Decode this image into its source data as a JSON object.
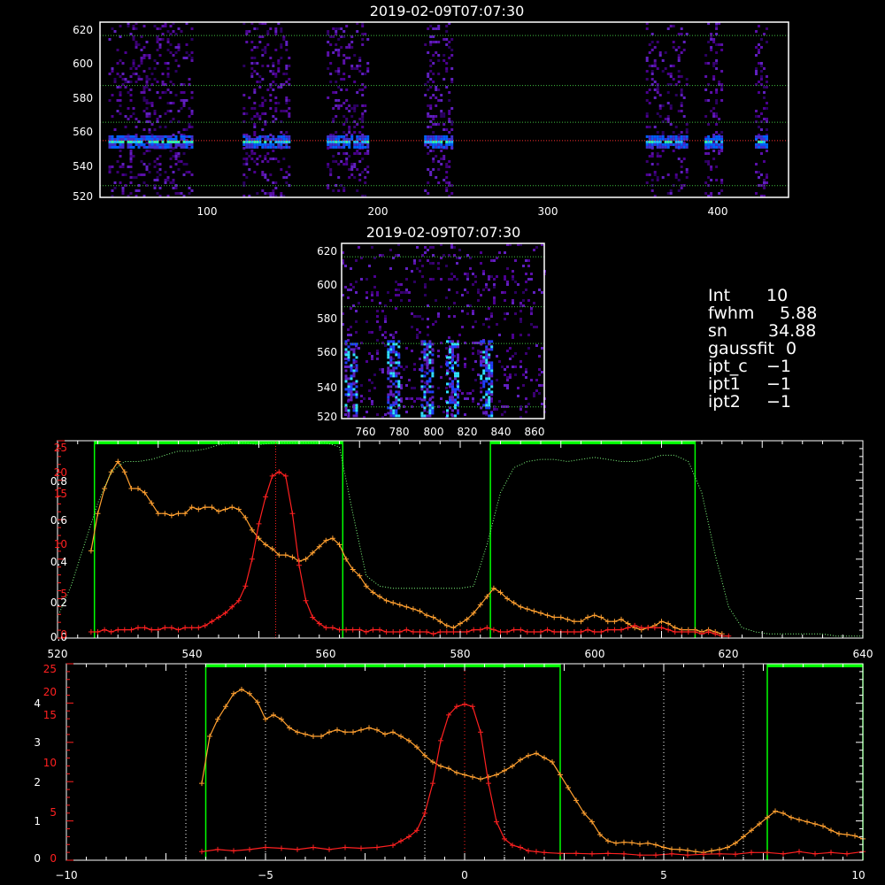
{
  "top_panel": {
    "title": "2019-02-09T07:07:30",
    "x_ticks": [
      "100",
      "200",
      "300",
      "400"
    ],
    "y_ticks": [
      "520",
      "540",
      "560",
      "580",
      "600",
      "620"
    ]
  },
  "mid_panel": {
    "title": "2019-02-09T07:07:30",
    "x_ticks": [
      "760",
      "780",
      "800",
      "820",
      "840",
      "860"
    ],
    "y_ticks": [
      "520",
      "540",
      "560",
      "580",
      "600",
      "620"
    ]
  },
  "info": {
    "rows": [
      {
        "key": "Int",
        "value": "10"
      },
      {
        "key": "fwhm",
        "value": "5.88"
      },
      {
        "key": "sn",
        "value": "34.88"
      },
      {
        "key": "gaussfit",
        "value": "0"
      },
      {
        "key": "ipt_c",
        "value": "−1"
      },
      {
        "key": "ipt1",
        "value": "−1"
      },
      {
        "key": "ipt2",
        "value": "−1"
      }
    ]
  },
  "colors": {
    "background": "#000000",
    "axes": "#ffffff",
    "orange": "#ffa030",
    "red": "#ff2020",
    "green": "#00ff00",
    "dotted_green": "#80ff80"
  },
  "chart_data": [
    {
      "type": "heatmap",
      "title": "2019-02-09T07:07:30",
      "xlim": [
        35,
        445
      ],
      "ylim": [
        518,
        623
      ],
      "bands_x": [
        [
          40,
          90
        ],
        [
          120,
          148
        ],
        [
          170,
          195
        ],
        [
          228,
          245
        ],
        [
          360,
          385
        ],
        [
          395,
          405
        ],
        [
          425,
          432
        ]
      ],
      "bright_row_y": 552,
      "guide_lines_y": [
        525,
        552,
        563,
        585,
        615
      ]
    },
    {
      "type": "heatmap",
      "title": "2019-02-09T07:07:30",
      "xlim": [
        745,
        865
      ],
      "ylim": [
        518,
        623
      ],
      "streak_x": [
        750,
        775,
        795,
        810,
        830
      ],
      "guide_lines_y": [
        525,
        563,
        585,
        615
      ]
    },
    {
      "type": "line",
      "xlim": [
        520,
        640
      ],
      "x_ticks": [
        "520",
        "540",
        "560",
        "580",
        "600",
        "620",
        "640"
      ],
      "y_ticks_white": [
        "0.0",
        "0.2",
        "0.4",
        "0.6",
        "0.8"
      ],
      "y_ticks_red": [
        "0",
        "5",
        "10",
        "15",
        "20",
        "25"
      ],
      "ylim_white": [
        0,
        0.95
      ],
      "ylim_red": [
        0,
        25
      ],
      "filter_windows": [
        [
          525.5,
          562.5
        ],
        [
          584.5,
          615
        ]
      ],
      "line_center": 552.5,
      "series": [
        {
          "color": "orange",
          "x": [
            525,
            526,
            527,
            528,
            529,
            530,
            531,
            532,
            533,
            534,
            535,
            536,
            537,
            538,
            539,
            540,
            541,
            542,
            543,
            544,
            545,
            546,
            547,
            548,
            549,
            550,
            551,
            552,
            553,
            554,
            555,
            556,
            557,
            558,
            559,
            560,
            561,
            562,
            563,
            564,
            565,
            566,
            567,
            568,
            569,
            570,
            571,
            572,
            573,
            574,
            575,
            576,
            577,
            578,
            579,
            580,
            581,
            582,
            583,
            584,
            585,
            586,
            587,
            588,
            589,
            590,
            591,
            592,
            593,
            594,
            595,
            596,
            597,
            598,
            599,
            600,
            601,
            602,
            603,
            604,
            605,
            606,
            607,
            608,
            609,
            610,
            611,
            612,
            613,
            614,
            615,
            616,
            617,
            618,
            619
          ],
          "y": [
            0.42,
            0.6,
            0.72,
            0.8,
            0.85,
            0.8,
            0.72,
            0.72,
            0.7,
            0.65,
            0.6,
            0.6,
            0.59,
            0.6,
            0.6,
            0.63,
            0.62,
            0.63,
            0.63,
            0.61,
            0.62,
            0.63,
            0.62,
            0.58,
            0.52,
            0.48,
            0.45,
            0.43,
            0.4,
            0.4,
            0.39,
            0.37,
            0.38,
            0.41,
            0.44,
            0.47,
            0.48,
            0.45,
            0.38,
            0.33,
            0.3,
            0.25,
            0.22,
            0.2,
            0.18,
            0.17,
            0.16,
            0.15,
            0.14,
            0.13,
            0.11,
            0.1,
            0.08,
            0.06,
            0.05,
            0.07,
            0.09,
            0.12,
            0.16,
            0.2,
            0.24,
            0.22,
            0.19,
            0.17,
            0.15,
            0.14,
            0.13,
            0.12,
            0.11,
            0.1,
            0.1,
            0.09,
            0.08,
            0.08,
            0.1,
            0.11,
            0.1,
            0.08,
            0.08,
            0.09,
            0.07,
            0.05,
            0.04,
            0.05,
            0.06,
            0.08,
            0.07,
            0.05,
            0.04,
            0.04,
            0.04,
            0.03,
            0.04,
            0.03,
            0.02
          ]
        },
        {
          "color": "red",
          "x": [
            525,
            526,
            527,
            528,
            529,
            530,
            531,
            532,
            533,
            534,
            535,
            536,
            537,
            538,
            539,
            540,
            541,
            542,
            543,
            544,
            545,
            546,
            547,
            548,
            549,
            550,
            551,
            552,
            553,
            554,
            555,
            556,
            557,
            558,
            559,
            560,
            561,
            562,
            563,
            564,
            565,
            566,
            567,
            568,
            569,
            570,
            571,
            572,
            573,
            574,
            575,
            576,
            577,
            578,
            579,
            580,
            581,
            582,
            583,
            584,
            585,
            586,
            587,
            588,
            589,
            590,
            591,
            592,
            593,
            594,
            595,
            596,
            597,
            598,
            599,
            600,
            601,
            602,
            603,
            604,
            605,
            606,
            607,
            608,
            609,
            610,
            611,
            612,
            613,
            614,
            615,
            616,
            617,
            618,
            619,
            620
          ],
          "y": [
            0.03,
            0.03,
            0.04,
            0.03,
            0.04,
            0.04,
            0.04,
            0.05,
            0.05,
            0.04,
            0.04,
            0.05,
            0.05,
            0.04,
            0.05,
            0.05,
            0.05,
            0.06,
            0.08,
            0.1,
            0.12,
            0.15,
            0.18,
            0.25,
            0.38,
            0.55,
            0.68,
            0.78,
            0.8,
            0.78,
            0.6,
            0.35,
            0.18,
            0.1,
            0.07,
            0.05,
            0.05,
            0.04,
            0.04,
            0.04,
            0.04,
            0.03,
            0.04,
            0.04,
            0.03,
            0.03,
            0.03,
            0.04,
            0.03,
            0.03,
            0.03,
            0.02,
            0.03,
            0.03,
            0.03,
            0.03,
            0.03,
            0.04,
            0.04,
            0.05,
            0.04,
            0.03,
            0.03,
            0.04,
            0.04,
            0.03,
            0.03,
            0.03,
            0.04,
            0.03,
            0.03,
            0.03,
            0.03,
            0.03,
            0.04,
            0.03,
            0.03,
            0.04,
            0.04,
            0.04,
            0.05,
            0.06,
            0.05,
            0.05,
            0.05,
            0.05,
            0.04,
            0.03,
            0.03,
            0.03,
            0.03,
            0.02,
            0.03,
            0.02,
            0.01,
            0.01
          ]
        },
        {
          "color": "dotted_green",
          "x": [
            520,
            522,
            524,
            526,
            528,
            530,
            532,
            534,
            536,
            538,
            540,
            542,
            544,
            546,
            548,
            550,
            552,
            554,
            556,
            558,
            560,
            562,
            564,
            566,
            568,
            570,
            572,
            574,
            576,
            578,
            580,
            582,
            584,
            586,
            588,
            590,
            592,
            594,
            596,
            598,
            600,
            602,
            604,
            606,
            608,
            610,
            612,
            614,
            616,
            618,
            620,
            622,
            624,
            626,
            628,
            630,
            632,
            634,
            636,
            638,
            640
          ],
          "y": [
            0.1,
            0.25,
            0.45,
            0.65,
            0.8,
            0.85,
            0.85,
            0.86,
            0.88,
            0.9,
            0.9,
            0.91,
            0.93,
            0.94,
            0.94,
            0.93,
            0.94,
            0.94,
            0.94,
            0.94,
            0.94,
            0.92,
            0.6,
            0.3,
            0.25,
            0.24,
            0.24,
            0.24,
            0.24,
            0.24,
            0.24,
            0.25,
            0.45,
            0.7,
            0.82,
            0.85,
            0.86,
            0.86,
            0.85,
            0.86,
            0.87,
            0.86,
            0.85,
            0.85,
            0.86,
            0.88,
            0.88,
            0.85,
            0.7,
            0.4,
            0.15,
            0.05,
            0.03,
            0.02,
            0.02,
            0.02,
            0.02,
            0.02,
            0.01,
            0.01,
            0.01
          ]
        }
      ]
    },
    {
      "type": "line",
      "xlim": [
        -10,
        10
      ],
      "x_ticks": [
        "−10",
        "−5",
        "0",
        "5",
        "10"
      ],
      "y_ticks_white": [
        "0",
        "1",
        "2",
        "3",
        "4"
      ],
      "y_ticks_red": [
        "0",
        "5",
        "10",
        "15",
        "20",
        "25"
      ],
      "ylim_white": [
        0,
        4.6
      ],
      "ylim_red": [
        0,
        25
      ],
      "filter_windows": [
        [
          -6.5,
          2.4
        ],
        [
          7.6,
          10
        ]
      ],
      "dotted_lines_x": [
        -7,
        -5,
        -1,
        0,
        1,
        5,
        7
      ],
      "series": [
        {
          "color": "orange",
          "x": [
            -6.6,
            -6.4,
            -6.2,
            -6.0,
            -5.8,
            -5.6,
            -5.4,
            -5.2,
            -5.0,
            -4.8,
            -4.6,
            -4.4,
            -4.2,
            -4.0,
            -3.8,
            -3.6,
            -3.4,
            -3.2,
            -3.0,
            -2.8,
            -2.6,
            -2.4,
            -2.2,
            -2.0,
            -1.8,
            -1.6,
            -1.4,
            -1.2,
            -1.0,
            -0.8,
            -0.6,
            -0.4,
            -0.2,
            0.0,
            0.2,
            0.4,
            0.6,
            0.8,
            1.0,
            1.2,
            1.4,
            1.6,
            1.8,
            2.0,
            2.2,
            2.4,
            2.6,
            2.8,
            3.0,
            3.2,
            3.4,
            3.6,
            3.8,
            4.0,
            4.2,
            4.4,
            4.6,
            4.8,
            5.0,
            5.2,
            5.4,
            5.6,
            5.8,
            6.0,
            6.2,
            6.4,
            6.6,
            6.8,
            7.0,
            7.2,
            7.4,
            7.6,
            7.8,
            8.0,
            8.2,
            8.4,
            8.6,
            8.8,
            9.0,
            9.2,
            9.4,
            9.6,
            9.8,
            10.0
          ],
          "y": [
            1.8,
            2.9,
            3.3,
            3.6,
            3.9,
            4.0,
            3.9,
            3.7,
            3.3,
            3.4,
            3.3,
            3.1,
            3.0,
            2.95,
            2.9,
            2.9,
            3.0,
            3.05,
            3.0,
            3.0,
            3.05,
            3.1,
            3.05,
            2.95,
            3.0,
            2.9,
            2.8,
            2.65,
            2.45,
            2.3,
            2.2,
            2.15,
            2.05,
            2.0,
            1.95,
            1.9,
            1.95,
            2.0,
            2.1,
            2.2,
            2.35,
            2.45,
            2.5,
            2.4,
            2.3,
            2.0,
            1.7,
            1.4,
            1.1,
            0.9,
            0.6,
            0.45,
            0.4,
            0.42,
            0.41,
            0.38,
            0.4,
            0.36,
            0.3,
            0.26,
            0.25,
            0.23,
            0.2,
            0.18,
            0.22,
            0.25,
            0.3,
            0.4,
            0.55,
            0.7,
            0.85,
            1.0,
            1.15,
            1.1,
            1.0,
            0.95,
            0.9,
            0.85,
            0.8,
            0.7,
            0.62,
            0.6,
            0.57,
            0.5
          ]
        },
        {
          "color": "red",
          "x": [
            -6.6,
            -6.2,
            -5.8,
            -5.4,
            -5.0,
            -4.6,
            -4.2,
            -3.8,
            -3.4,
            -3.0,
            -2.6,
            -2.2,
            -1.8,
            -1.6,
            -1.4,
            -1.2,
            -1.0,
            -0.8,
            -0.6,
            -0.4,
            -0.2,
            0.0,
            0.2,
            0.4,
            0.6,
            0.8,
            1.0,
            1.2,
            1.4,
            1.6,
            1.8,
            2.0,
            2.4,
            2.8,
            3.2,
            3.6,
            4.0,
            4.4,
            4.8,
            5.2,
            5.6,
            6.0,
            6.4,
            6.8,
            7.2,
            7.6,
            8.0,
            8.4,
            8.8,
            9.2,
            9.6,
            10.0
          ],
          "y": [
            0.2,
            0.25,
            0.22,
            0.25,
            0.3,
            0.28,
            0.25,
            0.3,
            0.25,
            0.3,
            0.28,
            0.3,
            0.35,
            0.45,
            0.55,
            0.7,
            1.1,
            1.8,
            2.8,
            3.4,
            3.6,
            3.65,
            3.6,
            3.0,
            1.8,
            0.9,
            0.5,
            0.35,
            0.3,
            0.22,
            0.2,
            0.18,
            0.16,
            0.16,
            0.15,
            0.16,
            0.15,
            0.12,
            0.12,
            0.15,
            0.12,
            0.14,
            0.15,
            0.14,
            0.18,
            0.18,
            0.15,
            0.2,
            0.15,
            0.18,
            0.15,
            0.2
          ]
        }
      ]
    }
  ]
}
